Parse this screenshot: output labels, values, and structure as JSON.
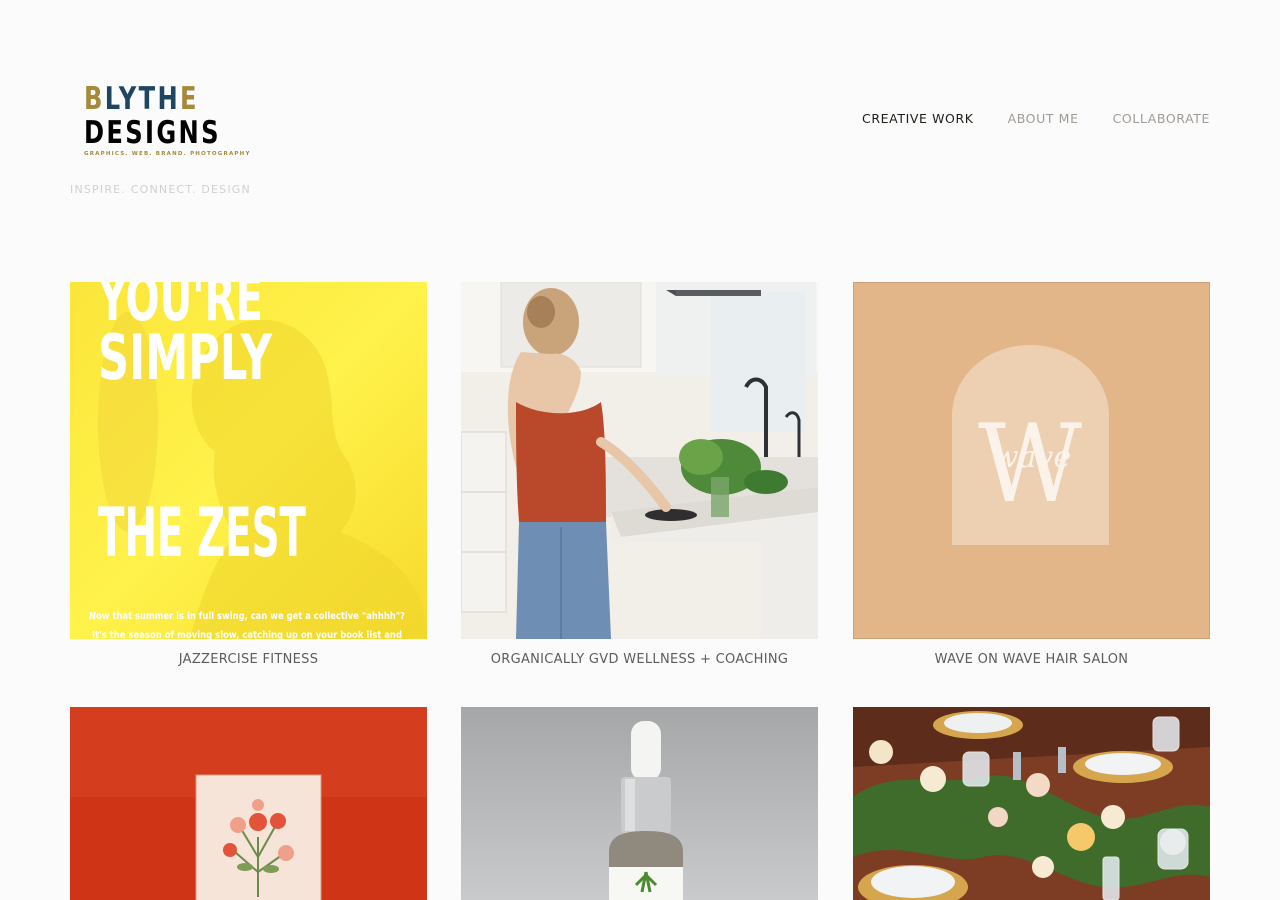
{
  "brand": {
    "logo_line1_first": "B",
    "logo_line1_rest": "LYTH",
    "logo_line1_last": "E",
    "logo_line2": "DESIGNS",
    "logo_sub": "GRAPHICS. WEB. BRAND. PHOTOGRAPHY",
    "tagline": "INSPIRE. CONNECT. DESIGN"
  },
  "nav": {
    "items": [
      {
        "label": "CREATIVE WORK",
        "active": true
      },
      {
        "label": "ABOUT ME",
        "active": false
      },
      {
        "label": "COLLABORATE",
        "active": false
      }
    ]
  },
  "portfolio": {
    "items": [
      {
        "caption": "JAZZERCISE FITNESS",
        "image_text": {
          "line1": "YOU'RE",
          "line2": "SIMPLY",
          "line3": "THE ZEST",
          "body1": "Now that summer is in full swing, can we get a collective \"ahhhh\"?",
          "body2": "It's the season of moving slow, catching up on your book list and"
        }
      },
      {
        "caption": "ORGANICALLY GVD WELLNESS + COACHING"
      },
      {
        "caption": "WAVE ON WAVE HAIR SALON",
        "image_text": {
          "script": "wave"
        }
      },
      {
        "caption": ""
      },
      {
        "caption": ""
      },
      {
        "caption": ""
      }
    ]
  },
  "colors": {
    "brand_gold": "#a68a3a",
    "brand_navy": "#1f4661",
    "nav_active": "#1f1c18",
    "nav_inactive": "#a09b96"
  }
}
